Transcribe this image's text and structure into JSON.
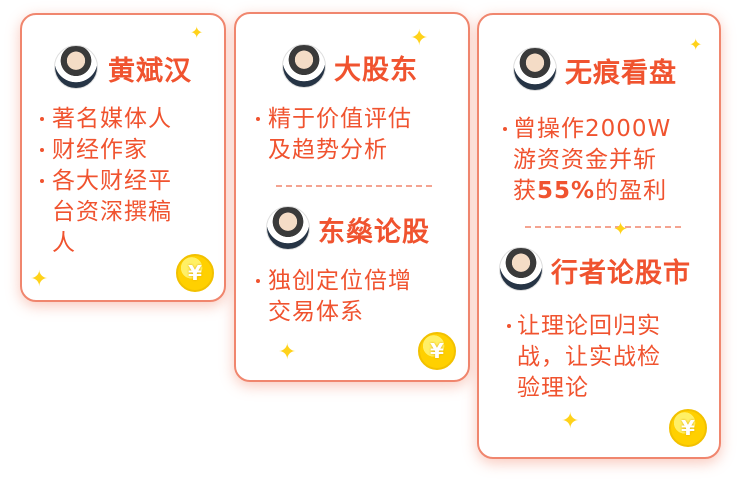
{
  "cards": [
    {
      "name": "黄斌汉",
      "lines": [
        "著名媒体人",
        "财经作家",
        "各大财经平",
        "台资深撰稿",
        "人"
      ],
      "coin": "¥"
    },
    {
      "sections": [
        {
          "name": "大股东",
          "lines": [
            "精于价值评估",
            "及趋势分析"
          ]
        },
        {
          "name": "东燊论股",
          "lines": [
            "独创定位倍增",
            "交易体系"
          ]
        }
      ],
      "coin": "¥"
    },
    {
      "sections": [
        {
          "name": "无痕看盘",
          "lines": [
            "曾操作2000W",
            "游资资金并斩",
            "获",
            "的盈利"
          ],
          "highlight": "55%"
        },
        {
          "name": "行者论股市",
          "lines": [
            "让理论回归实",
            "战，让实战检",
            "验理论"
          ]
        }
      ],
      "coin": "¥"
    }
  ],
  "colors": {
    "accent": "#f0532f",
    "border": "#f0866e",
    "coin": "#ffd000"
  },
  "icons": [
    "avatar",
    "bullet-dot",
    "yuan-coin-icon",
    "sparkle-icon"
  ]
}
